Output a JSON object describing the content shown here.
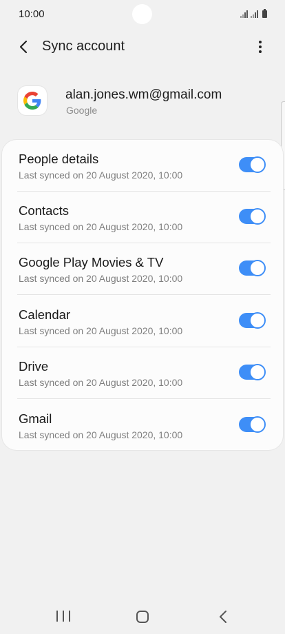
{
  "status_bar": {
    "time": "10:00",
    "icons": [
      "signal-icon",
      "signal-icon",
      "battery-icon"
    ]
  },
  "app_bar": {
    "title": "Sync account",
    "back_icon": "chevron-left-icon",
    "more_icon": "more-vertical-icon"
  },
  "account": {
    "email": "alan.jones.wm@gmail.com",
    "type": "Google",
    "logo_icon": "google-logo-icon"
  },
  "sync_items": [
    {
      "title": "People details",
      "subtitle": "Last synced on 20 August 2020, 10:00",
      "enabled": true
    },
    {
      "title": "Contacts",
      "subtitle": "Last synced on 20 August 2020, 10:00",
      "enabled": true
    },
    {
      "title": "Google Play Movies & TV",
      "subtitle": "Last synced on 20 August 2020, 10:00",
      "enabled": true
    },
    {
      "title": "Calendar",
      "subtitle": "Last synced on 20 August 2020, 10:00",
      "enabled": true
    },
    {
      "title": "Drive",
      "subtitle": "Last synced on 20 August 2020, 10:00",
      "enabled": true
    },
    {
      "title": "Gmail",
      "subtitle": "Last synced on 20 August 2020, 10:00",
      "enabled": true
    }
  ],
  "nav_bar": {
    "icons": [
      "recent-apps-icon",
      "home-icon",
      "back-icon"
    ]
  },
  "colors": {
    "accent": "#3e8ef7",
    "background": "#f1f1f1",
    "card": "#fcfcfc"
  }
}
